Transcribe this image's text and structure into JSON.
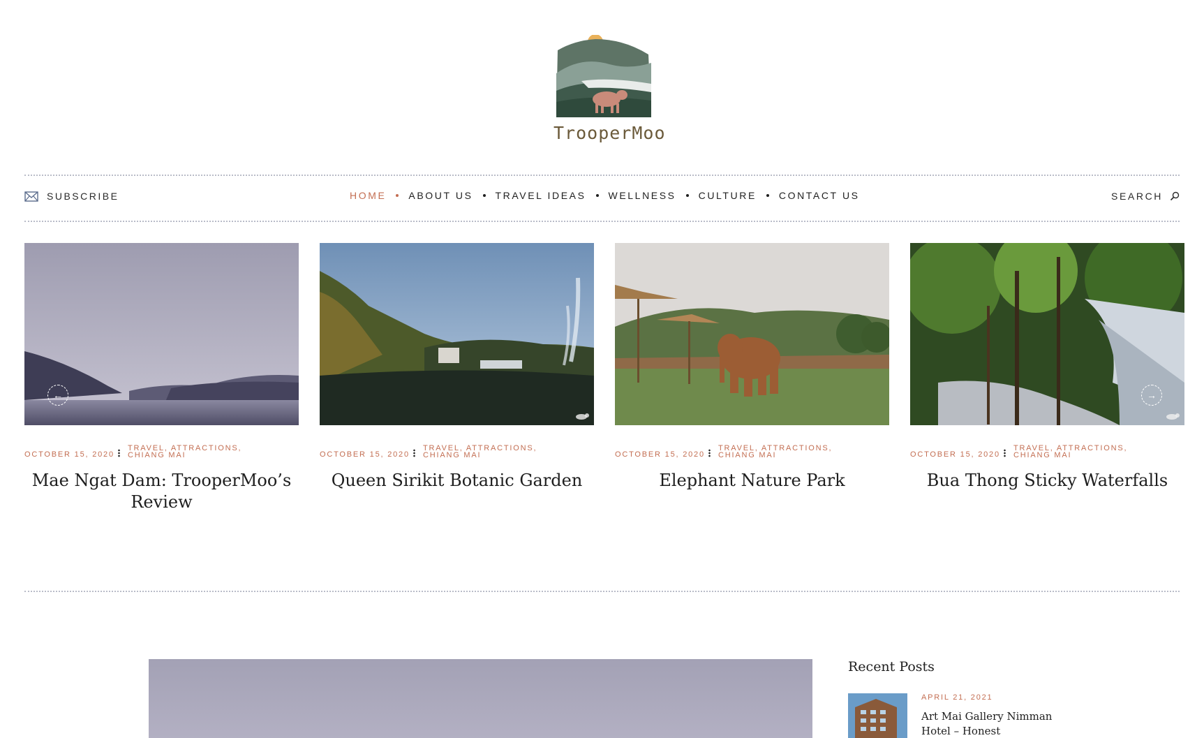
{
  "brand": {
    "name": "TrooperMoo",
    "accent_color": "#c36e52"
  },
  "header": {
    "subscribe_label": "SUBSCRIBE",
    "search_label": "SEARCH",
    "nav": [
      {
        "label": "HOME",
        "active": true
      },
      {
        "label": "ABOUT US",
        "active": false
      },
      {
        "label": "TRAVEL IDEAS",
        "active": false
      },
      {
        "label": "WELLNESS",
        "active": false
      },
      {
        "label": "CULTURE",
        "active": false
      },
      {
        "label": "CONTACT US",
        "active": false
      }
    ]
  },
  "slider": {
    "cards": [
      {
        "date": "OCTOBER 15, 2020",
        "categories": "TRAVEL, ATTRACTIONS, CHIANG MAI",
        "title": "Mae Ngat Dam: TrooperMoo’s Review",
        "image": "misty-lake-mountains"
      },
      {
        "date": "OCTOBER 15, 2020",
        "categories": "TRAVEL, ATTRACTIONS, CHIANG MAI",
        "title": "Queen Sirikit Botanic Garden",
        "image": "garden-fountain"
      },
      {
        "date": "OCTOBER 15, 2020",
        "categories": "TRAVEL, ATTRACTIONS, CHIANG MAI",
        "title": "Elephant Nature Park",
        "image": "elephant-field"
      },
      {
        "date": "OCTOBER 15, 2020",
        "categories": "TRAVEL, ATTRACTIONS, CHIANG MAI",
        "title": "Bua Thong Sticky Waterfalls",
        "image": "jungle-waterfall"
      }
    ]
  },
  "sidebar": {
    "recent_heading": "Recent Posts",
    "recent_posts": [
      {
        "date": "APRIL 21, 2021",
        "title": "Art Mai Gallery Nimman Hotel – Honest"
      }
    ]
  },
  "icons": {
    "subscribe": "envelope-icon",
    "search": "search-icon",
    "prev": "arrow-left-icon",
    "next": "arrow-right-icon"
  }
}
